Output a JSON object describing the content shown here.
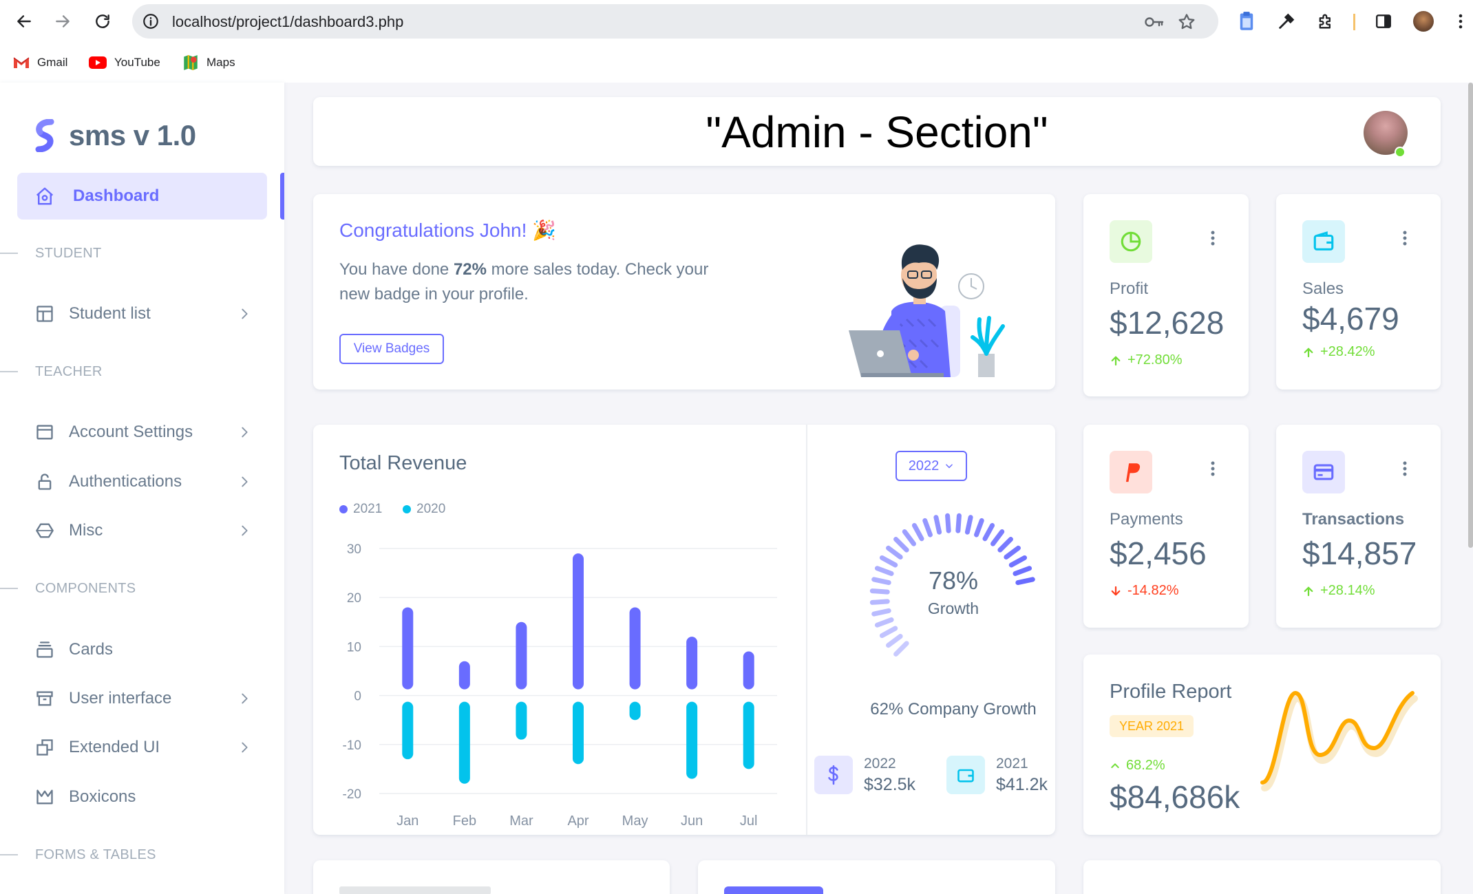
{
  "browser": {
    "url": "localhost/project1/dashboard3.php",
    "bookmarks": [
      {
        "label": "Gmail",
        "icon": "gmail-icon"
      },
      {
        "label": "YouTube",
        "icon": "youtube-icon"
      },
      {
        "label": "Maps",
        "icon": "maps-icon"
      }
    ]
  },
  "sidebar": {
    "brand": "sms v 1.0",
    "active_item": "Dashboard",
    "sections": {
      "student": "STUDENT",
      "teacher": "TEACHER",
      "components": "COMPONENTS",
      "forms_tables": "FORMS & TABLES"
    },
    "items": {
      "student_list": "Student list",
      "account_settings": "Account Settings",
      "authentications": "Authentications",
      "misc": "Misc",
      "cards": "Cards",
      "user_interface": "User interface",
      "extended_ui": "Extended UI",
      "boxicons": "Boxicons"
    }
  },
  "header": {
    "title": "\"Admin - Section\""
  },
  "welcome": {
    "title": "Congratulations John! 🎉",
    "text_before": "You have done ",
    "text_bold": "72%",
    "text_after": " more sales today. Check your new badge in your profile.",
    "button": "View Badges"
  },
  "stats": {
    "profit": {
      "label": "Profit",
      "value": "$12,628",
      "change": "+72.80%",
      "direction": "up"
    },
    "sales": {
      "label": "Sales",
      "value": "$4,679",
      "change": "+28.42%",
      "direction": "up"
    },
    "payments": {
      "label": "Payments",
      "value": "$2,456",
      "change": "-14.82%",
      "direction": "down"
    },
    "transactions": {
      "label": "Transactions",
      "value": "$14,857",
      "change": "+28.14%",
      "direction": "up"
    }
  },
  "revenue": {
    "title": "Total Revenue",
    "year_select": "2022",
    "growth_percent": "78%",
    "growth_label": "Growth",
    "company_growth": "62% Company Growth",
    "summary": [
      {
        "year": "2022",
        "amount": "$32.5k",
        "icon": "dollar-icon"
      },
      {
        "year": "2021",
        "amount": "$41.2k",
        "icon": "wallet-icon"
      }
    ]
  },
  "profile_report": {
    "title": "Profile Report",
    "badge": "YEAR 2021",
    "change": "68.2%",
    "value": "$84,686k"
  },
  "colors": {
    "primary": "#696cff",
    "info": "#03c3ec",
    "success": "#71dd37",
    "danger": "#ff3e1d",
    "warning": "#ffab00"
  },
  "chart_data": {
    "type": "bar",
    "categories": [
      "Jan",
      "Feb",
      "Mar",
      "Apr",
      "May",
      "Jun",
      "Jul"
    ],
    "series": [
      {
        "name": "2021",
        "values": [
          18,
          7,
          15,
          29,
          18,
          12,
          9
        ]
      },
      {
        "name": "2020",
        "values": [
          -13,
          -18,
          -9,
          -14,
          -5,
          -17,
          -15
        ]
      }
    ],
    "yticks": [
      30,
      20,
      10,
      0,
      -10,
      -20
    ],
    "ylim": [
      -20,
      30
    ],
    "legend_position": "top-left",
    "grid": true
  }
}
